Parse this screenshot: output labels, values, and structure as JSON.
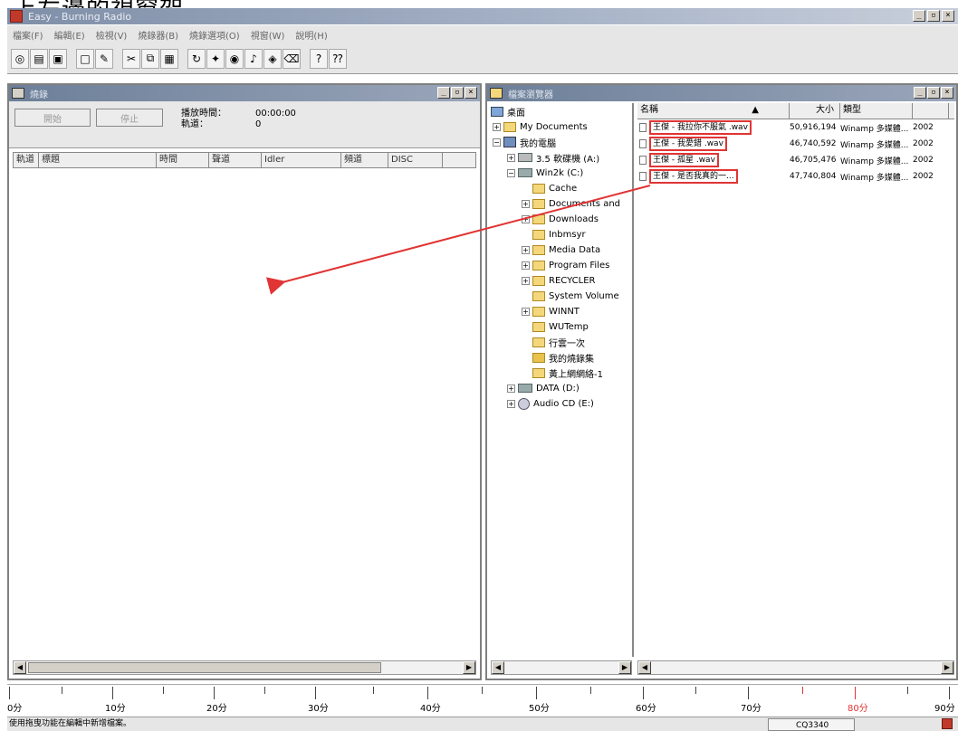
{
  "caption": "上左邊的視窗架。",
  "window": {
    "title": "Easy - Burning Radio"
  },
  "menu": [
    "檔案(F)",
    "編輯(E)",
    "檢視(V)",
    "燒錄器(B)",
    "燒錄選項(O)",
    "視窗(W)",
    "說明(H)"
  ],
  "left_pane": {
    "title": "燒錄",
    "start_label": "開始",
    "stop_label": "停止",
    "play_time_label": "播放時間：",
    "play_time_value": "00:00:00",
    "tracks_label": "軌道：",
    "tracks_value": "0",
    "columns": [
      "軌道",
      "標題",
      "時間",
      "聲道",
      "Idler",
      "頻道",
      "DISC"
    ]
  },
  "right_pane": {
    "title": "檔案瀏覽器",
    "tree": [
      {
        "label": "桌面",
        "icon": "desktop-icon"
      },
      {
        "label": "My Documents",
        "icon": "folder-icon",
        "exp": "+"
      },
      {
        "label": "我的電腦",
        "icon": "computer-icon",
        "exp": "−"
      },
      {
        "label": "3.5 軟碟機 (A:)",
        "icon": "floppy-icon",
        "exp": "+"
      },
      {
        "label": "Win2k (C:)",
        "icon": "drive-icon",
        "exp": "−"
      },
      {
        "label": "Cache",
        "icon": "folder-icon"
      },
      {
        "label": "Documents and",
        "icon": "folder-icon",
        "exp": "+"
      },
      {
        "label": "Downloads",
        "icon": "folder-icon",
        "exp": "+"
      },
      {
        "label": "Inbmsyr",
        "icon": "folder-icon"
      },
      {
        "label": "Media Data",
        "icon": "folder-icon",
        "exp": "+"
      },
      {
        "label": "Program Files",
        "icon": "folder-icon",
        "exp": "+"
      },
      {
        "label": "RECYCLER",
        "icon": "folder-icon",
        "exp": "+"
      },
      {
        "label": "System Volume",
        "icon": "folder-icon"
      },
      {
        "label": "WINNT",
        "icon": "folder-icon",
        "exp": "+"
      },
      {
        "label": "WUTemp",
        "icon": "folder-icon"
      },
      {
        "label": "行雲一次",
        "icon": "folder-icon"
      },
      {
        "label": "我的燒錄集",
        "icon": "folder-icon"
      },
      {
        "label": "黃上網網絡-1",
        "icon": "folder-icon"
      },
      {
        "label": "DATA (D:)",
        "icon": "drive-icon",
        "exp": "+"
      },
      {
        "label": "Audio CD (E:)",
        "icon": "cd-icon",
        "exp": "+"
      }
    ],
    "file_columns": [
      "名稱",
      "大小",
      "類型",
      ""
    ],
    "files": [
      {
        "name": "王傑 - 我拉你不服氣 .wav",
        "size": "50,916,194",
        "type": "Winamp 多媒體...",
        "date": "2002"
      },
      {
        "name": "王傑 - 我愛錯 .wav",
        "size": "46,740,592",
        "type": "Winamp 多媒體...",
        "date": "2002"
      },
      {
        "name": "王傑 - 孤星 .wav",
        "size": "46,705,476",
        "type": "Winamp 多媒體...",
        "date": "2002"
      },
      {
        "name": "王傑 - 是否我真的一... ",
        "size": "47,740,804",
        "type": "Winamp 多媒體...",
        "date": "2002"
      }
    ]
  },
  "ruler": {
    "labels": [
      "0分",
      "10分",
      "20分",
      "30分",
      "40分",
      "50分",
      "60分",
      "70分",
      "80分",
      "90分"
    ],
    "accent": "#e13434"
  },
  "status": {
    "text": "使用拖曳功能在編輯中新增檔案。",
    "count": "CQ3340"
  },
  "colors": {
    "highlight": "#e13434",
    "titlebar": "#7f8fa8"
  }
}
